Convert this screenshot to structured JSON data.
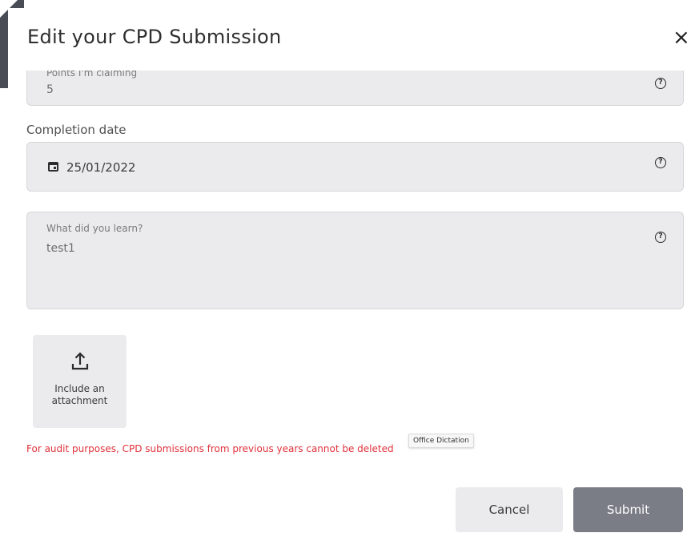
{
  "modal": {
    "title": "Edit your CPD Submission",
    "close_glyph": "×"
  },
  "points": {
    "label": "Points I'm claiming",
    "value": "5",
    "help_icon": "help-circle-icon",
    "help_glyph": "?"
  },
  "completion_date": {
    "label": "Completion date",
    "value": "25/01/2022",
    "icon": "calendar-icon",
    "help_glyph": "?"
  },
  "learn": {
    "label": "What did you learn?",
    "value": "test1",
    "help_glyph": "?"
  },
  "attachment": {
    "icon": "upload-icon",
    "label_line1": "Include an",
    "label_line2": "attachment"
  },
  "audit_note": "For audit purposes, CPD submissions from previous years cannot be deleted",
  "tooltip": "Office Dictation",
  "buttons": {
    "cancel": "Cancel",
    "submit": "Submit"
  },
  "colors": {
    "field_bg": "#ebebed",
    "submit_bg": "#7a7c86",
    "error_text": "#e0303a",
    "backdrop": "#4a4c55"
  }
}
